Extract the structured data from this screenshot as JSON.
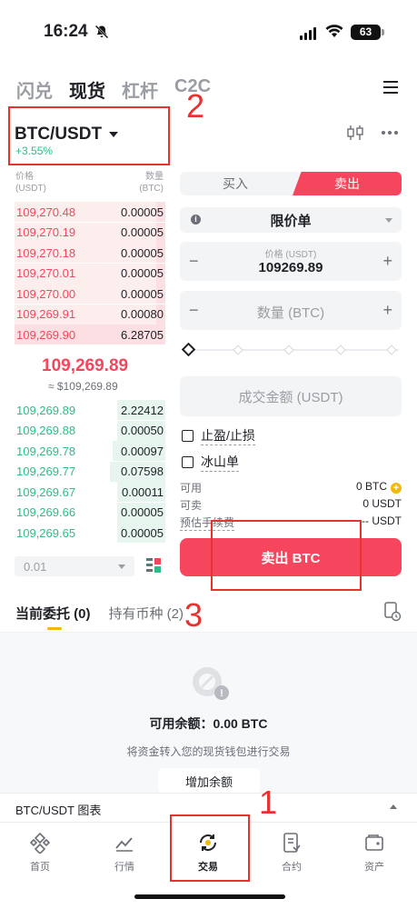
{
  "status": {
    "time": "16:24",
    "battery": "63"
  },
  "top_tabs": [
    {
      "label": "闪兑",
      "active": false
    },
    {
      "label": "现货",
      "active": true
    },
    {
      "label": "杠杆",
      "active": false
    },
    {
      "label": "C2C",
      "active": false
    }
  ],
  "pair": {
    "name": "BTC/USDT",
    "change": "+3.55%"
  },
  "annotations": {
    "one": "1",
    "two": "2",
    "three": "3"
  },
  "order_book": {
    "header": {
      "price": "价格",
      "price_unit": "(USDT)",
      "qty": "数量",
      "qty_unit": "(BTC)"
    },
    "asks": [
      {
        "price": "109,270.48",
        "qty": "0.00005",
        "depth": 0.06
      },
      {
        "price": "109,270.19",
        "qty": "0.00005",
        "depth": 0.06
      },
      {
        "price": "109,270.18",
        "qty": "0.00005",
        "depth": 0.06
      },
      {
        "price": "109,270.01",
        "qty": "0.00005",
        "depth": 0.06
      },
      {
        "price": "109,270.00",
        "qty": "0.00005",
        "depth": 0.06
      },
      {
        "price": "109,269.91",
        "qty": "0.00080",
        "depth": 0.06
      },
      {
        "price": "109,269.90",
        "qty": "6.28705",
        "depth": 1.0
      }
    ],
    "mid_price": "109,269.89",
    "mid_usd": "≈ $109,269.89",
    "bids": [
      {
        "price": "109,269.89",
        "qty": "2.22412",
        "depth": 0.32
      },
      {
        "price": "109,269.88",
        "qty": "0.00050",
        "depth": 0.32
      },
      {
        "price": "109,269.78",
        "qty": "0.00097",
        "depth": 0.35
      },
      {
        "price": "109,269.77",
        "qty": "0.07598",
        "depth": 0.37
      },
      {
        "price": "109,269.67",
        "qty": "0.00011",
        "depth": 0.32
      },
      {
        "price": "109,269.66",
        "qty": "0.00005",
        "depth": 0.32
      },
      {
        "price": "109,269.65",
        "qty": "0.00005",
        "depth": 0.32
      }
    ],
    "depth_selector": "0.01"
  },
  "trade_panel": {
    "buy_label": "买入",
    "sell_label": "卖出",
    "order_type": "限价单",
    "info_glyph": "i",
    "minus": "−",
    "plus": "+",
    "price_label": "价格 (USDT)",
    "price_value": "109269.89",
    "qty_placeholder": "数量 (BTC)",
    "amount_placeholder": "成交金额 (USDT)",
    "tp_sl": "止盈/止损",
    "iceberg": "冰山单",
    "available_label": "可用",
    "available_value": "0 BTC",
    "sellable_label": "可卖",
    "sellable_value": "0 USDT",
    "fee_label": "预估手续费",
    "fee_value": "-- USDT",
    "sell_button": "卖出 BTC"
  },
  "orders": {
    "tab_current": "当前委托 (0)",
    "tab_holdings": "持有币种 (2)",
    "balance": "可用余额：0.00 BTC",
    "hint": "将资金转入您的现货钱包进行交易",
    "add_button": "增加余额"
  },
  "chart_bar": {
    "label": "BTC/USDT 图表"
  },
  "bottom_nav": [
    {
      "label": "首页",
      "icon": "home-icon"
    },
    {
      "label": "行情",
      "icon": "markets-icon"
    },
    {
      "label": "交易",
      "icon": "trade-icon"
    },
    {
      "label": "合约",
      "icon": "futures-icon"
    },
    {
      "label": "资产",
      "icon": "wallet-icon"
    }
  ],
  "colors": {
    "ask": "#f6465d",
    "bid": "#2ebd85",
    "accent": "#f0b90b",
    "annotation": "#e8322f"
  }
}
